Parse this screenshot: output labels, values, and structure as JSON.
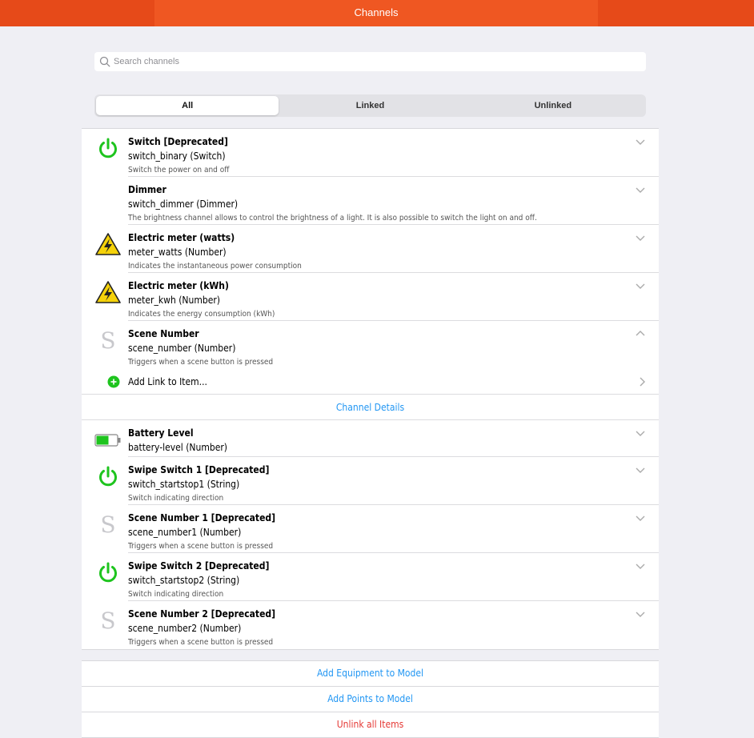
{
  "header": {
    "title": "Channels"
  },
  "search": {
    "placeholder": "Search channels"
  },
  "filters": {
    "all": "All",
    "linked": "Linked",
    "unlinked": "Unlinked",
    "selected": "All"
  },
  "channels": [
    {
      "name": "Switch [Deprecated]",
      "sub": "switch_binary (Switch)",
      "desc": "Switch the power on and off",
      "icon": "power-icon"
    },
    {
      "name": "Dimmer",
      "sub": "switch_dimmer (Dimmer)",
      "desc": "The brightness channel allows to control the brightness of a light. It is also possible to switch the light on and off.",
      "icon": "none"
    },
    {
      "name": "Electric meter (watts)",
      "sub": "meter_watts (Number)",
      "desc": "Indicates the instantaneous power consumption",
      "icon": "electricity-warning-icon"
    },
    {
      "name": "Electric meter (kWh)",
      "sub": "meter_kwh (Number)",
      "desc": "Indicates the energy consumption (kWh)",
      "icon": "electricity-warning-icon"
    },
    {
      "name": "Scene Number",
      "sub": "scene_number (Number)",
      "desc": "Triggers when a scene button is pressed",
      "icon": "letter-s-icon",
      "icon_letter": "S"
    },
    {
      "name": "Battery Level",
      "sub": "battery-level (Number)",
      "icon": "battery-icon",
      "battery_level": 0.6
    },
    {
      "name": "Swipe Switch 1 [Deprecated]",
      "sub": "switch_startstop1 (String)",
      "desc": "Switch indicating direction",
      "icon": "power-icon"
    },
    {
      "name": "Scene Number 1 [Deprecated]",
      "sub": "scene_number1 (Number)",
      "desc": "Triggers when a scene button is pressed",
      "icon": "letter-s-icon",
      "icon_letter": "S"
    },
    {
      "name": "Swipe Switch 2 [Deprecated]",
      "sub": "switch_startstop2 (String)",
      "desc": "Switch indicating direction",
      "icon": "power-icon"
    },
    {
      "name": "Scene Number 2 [Deprecated]",
      "sub": "scene_number2 (Number)",
      "desc": "Triggers when a scene button is pressed",
      "icon": "letter-s-icon",
      "icon_letter": "S"
    }
  ],
  "expanded": {
    "add_link": "Add Link to Item...",
    "details": "Channel Details"
  },
  "actions": {
    "add_equipment": "Add Equipment to Model",
    "add_points": "Add Points to Model",
    "unlink_all": "Unlink all Items"
  },
  "colors": {
    "header_bg": "#e64a19",
    "header_tab": "#ef5722",
    "accent_green": "#1ec41e",
    "link_blue": "#2196f3",
    "danger_red": "#e53935",
    "warning_yellow": "#f5d20a"
  }
}
